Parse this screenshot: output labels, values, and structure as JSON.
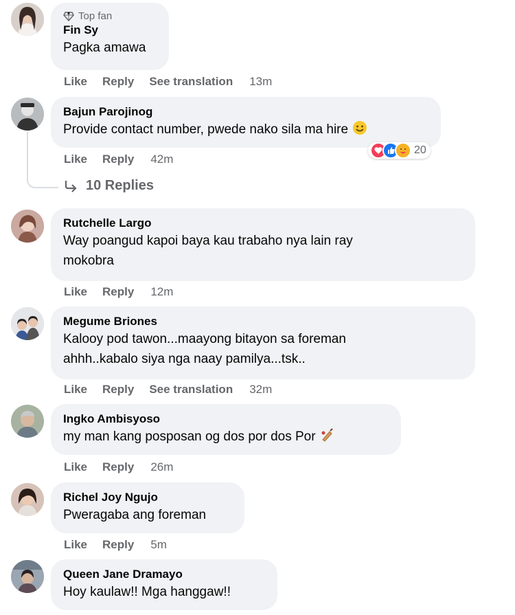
{
  "comments": [
    {
      "author": "Fin Sy",
      "badge": "Top fan",
      "text": "Pagka amawa",
      "actions": {
        "like": "Like",
        "reply": "Reply",
        "translate": "See translation",
        "time": "13m"
      }
    },
    {
      "author": "Bajun Parojinog",
      "text": "Provide contact number, pwede nako sila ma hire",
      "actions": {
        "like": "Like",
        "reply": "Reply",
        "time": "42m"
      },
      "reactions": {
        "count": "20",
        "icons": [
          "heart-icon",
          "like-icon",
          "care-icon"
        ]
      },
      "replies": "10 Replies"
    },
    {
      "author": "Rutchelle Largo",
      "text_line1": "Way poangud kapoi baya kau trabaho nya lain ray",
      "text_line2": "mokobra",
      "actions": {
        "like": "Like",
        "reply": "Reply",
        "time": "12m"
      }
    },
    {
      "author": "Megume Briones",
      "text_line1": "Kalooy pod tawon...maayong bitayon sa foreman",
      "text_line2": "ahhh..kabalo siya nga naay pamilya...tsk..",
      "actions": {
        "like": "Like",
        "reply": "Reply",
        "translate": "See translation",
        "time": "32m"
      }
    },
    {
      "author": "Ingko Ambisyoso",
      "text": "my man kang posposan og dos por dos Por",
      "actions": {
        "like": "Like",
        "reply": "Reply",
        "time": "26m"
      }
    },
    {
      "author": "Richel Joy Ngujo",
      "text": "Pweragaba ang foreman",
      "actions": {
        "like": "Like",
        "reply": "Reply",
        "time": "5m"
      }
    },
    {
      "author": "Queen Jane Dramayo",
      "text": "Hoy kaulaw!! Mga hanggaw!!"
    }
  ],
  "colors": {
    "bubble": "#f0f2f5",
    "meta": "#65676b",
    "love": "#f33e58",
    "like": "#1877f2",
    "care": "#f7b125"
  }
}
